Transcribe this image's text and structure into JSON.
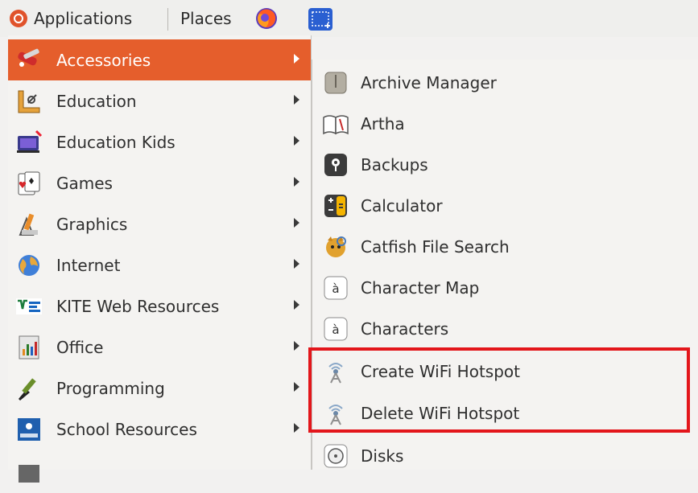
{
  "panel": {
    "applications_label": "Applications",
    "places_label": "Places",
    "icons": [
      "ubuntu-logo-icon",
      "firefox-icon",
      "screenshot-selection-icon"
    ]
  },
  "main_menu": {
    "items": [
      {
        "label": "Accessories",
        "icon": "accessories-icon",
        "active": true
      },
      {
        "label": "Education",
        "icon": "education-icon"
      },
      {
        "label": "Education Kids",
        "icon": "education-kids-icon"
      },
      {
        "label": "Games",
        "icon": "games-icon"
      },
      {
        "label": "Graphics",
        "icon": "graphics-icon"
      },
      {
        "label": "Internet",
        "icon": "internet-globe-icon"
      },
      {
        "label": "KITE Web Resources",
        "icon": "kite-icon"
      },
      {
        "label": "Office",
        "icon": "office-icon"
      },
      {
        "label": "Programming",
        "icon": "programming-icon"
      },
      {
        "label": "School Resources",
        "icon": "school-icon"
      }
    ]
  },
  "sub_menu": {
    "items": [
      {
        "label": "Archive Manager",
        "icon": "archive-icon"
      },
      {
        "label": "Artha",
        "icon": "book-icon"
      },
      {
        "label": "Backups",
        "icon": "backups-icon"
      },
      {
        "label": "Calculator",
        "icon": "calculator-icon"
      },
      {
        "label": "Catfish File Search",
        "icon": "catfish-icon"
      },
      {
        "label": "Character Map",
        "icon": "character-map-icon"
      },
      {
        "label": "Characters",
        "icon": "characters-icon"
      },
      {
        "label": "Create WiFi Hotspot",
        "icon": "wifi-hotspot-icon"
      },
      {
        "label": "Delete WiFi Hotspot",
        "icon": "wifi-hotspot-icon"
      },
      {
        "label": "Disks",
        "icon": "disks-icon"
      }
    ],
    "char_glyph": "à"
  },
  "colors": {
    "active": "#e55e2c",
    "highlight": "#e3161b",
    "menu_bg": "#f4f3f1"
  }
}
